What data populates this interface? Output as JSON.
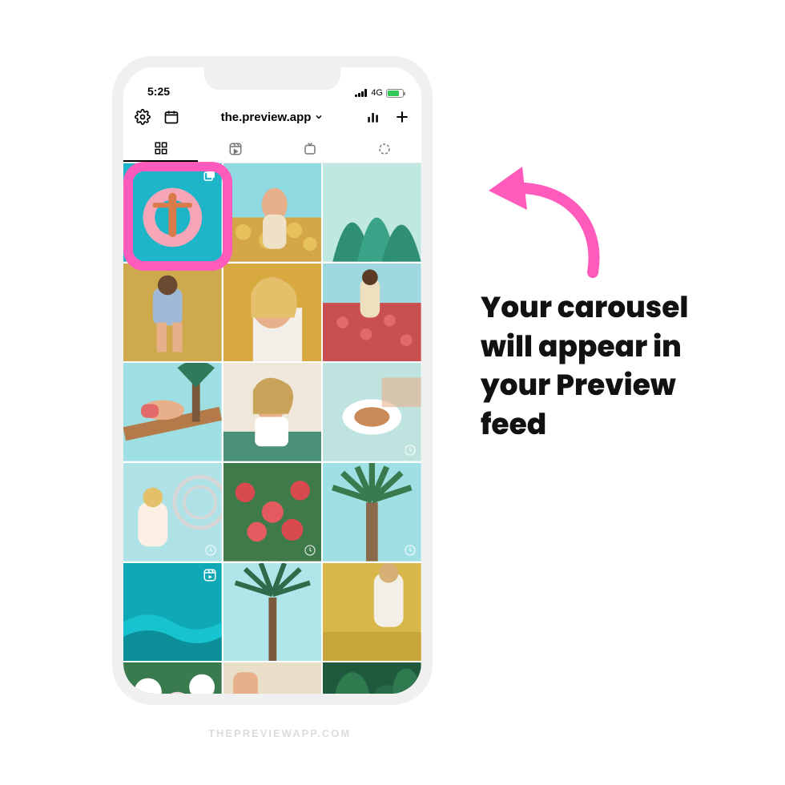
{
  "status": {
    "time": "5:25",
    "network_label": "4G"
  },
  "toolbar": {
    "account_name": "the.preview.app"
  },
  "annotation": {
    "text": "Your carousel will appear in your Preview feed"
  },
  "watermark": "THEPREVIEWAPP.COM",
  "colors": {
    "accent_pink": "#ff5bbd",
    "battery_green": "#34c759"
  },
  "grid_items": [
    {
      "name": "pool-float",
      "has_carousel_badge": true
    },
    {
      "name": "sunflower-pose"
    },
    {
      "name": "tropical-leaves"
    },
    {
      "name": "field-sitting"
    },
    {
      "name": "blonde-profile"
    },
    {
      "name": "poppy-field"
    },
    {
      "name": "palm-lounge"
    },
    {
      "name": "cafe-portrait"
    },
    {
      "name": "latte-table",
      "has_clock_badge": true
    },
    {
      "name": "white-dress",
      "has_clock_badge": true
    },
    {
      "name": "red-flowers",
      "has_clock_badge": true
    },
    {
      "name": "palm-sky",
      "has_clock_badge": true
    },
    {
      "name": "teal-sea",
      "has_reel_badge": true
    },
    {
      "name": "single-palm"
    },
    {
      "name": "yellow-field"
    },
    {
      "name": "hydrangea"
    },
    {
      "name": "morning-coffee"
    },
    {
      "name": "green-foliage"
    }
  ]
}
